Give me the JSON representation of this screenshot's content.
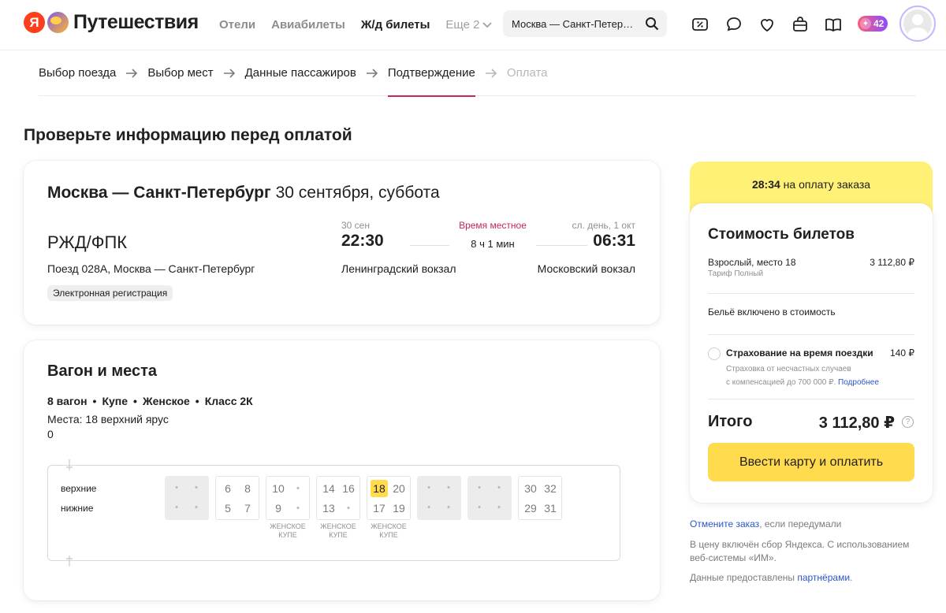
{
  "header": {
    "logo_letter": "Я",
    "logo_text": "Путешествия",
    "nav": [
      {
        "label": "Отели",
        "active": false
      },
      {
        "label": "Авиабилеты",
        "active": false
      },
      {
        "label": "Ж/д билеты",
        "active": true
      }
    ],
    "more_label": "Еще 2",
    "search_value": "Москва — Санкт-Петербург",
    "plus_count": "42"
  },
  "steps": [
    {
      "label": "Выбор поезда",
      "state": "done"
    },
    {
      "label": "Выбор мест",
      "state": "done"
    },
    {
      "label": "Данные пассажиров",
      "state": "done"
    },
    {
      "label": "Подтверждение",
      "state": "current"
    },
    {
      "label": "Оплата",
      "state": "disabled"
    }
  ],
  "page_title": "Проверьте информацию перед оплатой",
  "route": {
    "title_bold": "Москва — Санкт-Петербург",
    "title_date": " 30 сентября, суббота",
    "carrier": "РЖД/ФПК",
    "train": "Поезд 028А, Москва — Санкт-Петербург",
    "tag": "Электронная регистрация",
    "departure": {
      "date": "30 сен",
      "time": "22:30",
      "station": "Ленинградский вокзал"
    },
    "arrival": {
      "date": "сл. день, 1 окт",
      "time": "06:31",
      "station": "Московский вокзал"
    },
    "local_time_label": "Время местное",
    "duration": "8 ч 1 мин"
  },
  "wagon": {
    "title": "Вагон и места",
    "meta": [
      "8 вагон",
      "Купе",
      "Женское",
      "Класс 2К"
    ],
    "seats_text": "Места: 18 верхний ярус",
    "zero_text": "0",
    "row_upper": "верхние",
    "row_lower": "нижние",
    "compartments": [
      {
        "upper": [
          "",
          ""
        ],
        "lower": [
          "",
          ""
        ],
        "open": false,
        "label": ""
      },
      {
        "upper": [
          "6",
          "8"
        ],
        "lower": [
          "5",
          "7"
        ],
        "open": true,
        "label": ""
      },
      {
        "upper": [
          "10",
          ""
        ],
        "lower": [
          "9",
          ""
        ],
        "open": true,
        "label": "ЖЕНСКОЕ КУПЕ"
      },
      {
        "upper": [
          "14",
          "16"
        ],
        "lower": [
          "13",
          ""
        ],
        "open": true,
        "label": "ЖЕНСКОЕ КУПЕ"
      },
      {
        "upper": [
          "18",
          "20"
        ],
        "lower": [
          "17",
          "19"
        ],
        "open": true,
        "label": "ЖЕНСКОЕ КУПЕ",
        "selected": "18"
      },
      {
        "upper": [
          "",
          ""
        ],
        "lower": [
          "",
          ""
        ],
        "open": false,
        "label": ""
      },
      {
        "upper": [
          "",
          ""
        ],
        "lower": [
          "",
          ""
        ],
        "open": false,
        "label": ""
      },
      {
        "upper": [
          "30",
          "32"
        ],
        "lower": [
          "29",
          "31"
        ],
        "open": true,
        "label": ""
      }
    ]
  },
  "payment": {
    "timer": "28:34",
    "timer_text": " на оплату заказа",
    "title": "Стоимость билетов",
    "passenger": "Взрослый, место 18",
    "tariff": "Тариф Полный",
    "passenger_price": "3 112,80 ₽",
    "linen": "Бельё включено в стоимость",
    "insurance_title": "Страхование на время поездки",
    "insurance_price": "140 ₽",
    "insurance_desc_1": "Страховка от несчастных случаев",
    "insurance_desc_2": "с компенсацией до 700 000 ₽.",
    "insurance_more": "Подробнее",
    "total_label": "Итого",
    "total_value": "3 112,80 ₽",
    "pay_button": "Ввести карту и оплатить"
  },
  "notes": {
    "cancel_link": "Отмените заказ",
    "cancel_rest": ", если передумали",
    "fee": "В цену включён сбор Яндекса. С использованием веб-системы «ИМ».",
    "data_prefix": "Данные предоставлены ",
    "data_link": "партнёрами",
    "data_suffix": "."
  },
  "colors": {
    "accent": "#c5255f",
    "yellow": "#ffdb4d",
    "timer_bg": "#fff176",
    "link": "#2b56c9"
  }
}
